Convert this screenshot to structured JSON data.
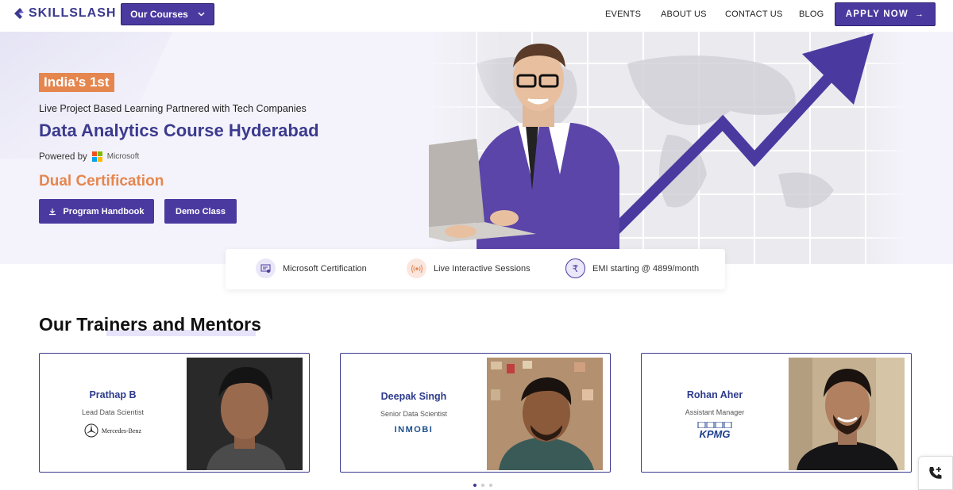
{
  "header": {
    "logo_text": "SKILLSLASH",
    "courses_button": "Our Courses",
    "nav": [
      "EVENTS",
      "ABOUT US",
      "CONTACT US",
      "BLOG"
    ],
    "apply_button": "APPLY NOW"
  },
  "hero": {
    "badge": "India’s 1st",
    "subtitle": "Live Project Based Learning Partnered with Tech Companies",
    "title": "Data Analytics Course Hyderabad",
    "powered_by": "Powered by",
    "powered_brand": "Microsoft",
    "dual_certification": "Dual Certification",
    "handbook_button": "Program Handbook",
    "demo_button": "Demo Class"
  },
  "features": [
    {
      "label": "Microsoft Certification",
      "icon": "certificate-icon"
    },
    {
      "label": "Live Interactive Sessions",
      "icon": "broadcast-icon"
    },
    {
      "label": "EMI starting @ 4899/month",
      "icon": "rupee-icon"
    }
  ],
  "trainers": {
    "title": "Our Trainers and Mentors",
    "items": [
      {
        "name": "Prathap B",
        "role": "Lead Data Scientist",
        "company": "Mercedes-Benz"
      },
      {
        "name": "Deepak Singh",
        "role": "Senior Data Scientist",
        "company": "INMOBI"
      },
      {
        "name": "Rohan Aher",
        "role": "Assistant Manager",
        "company": "KPMG"
      }
    ]
  },
  "colors": {
    "brand": "#4a3aa0",
    "accent": "#e5864e",
    "title": "#3b3a8e"
  }
}
